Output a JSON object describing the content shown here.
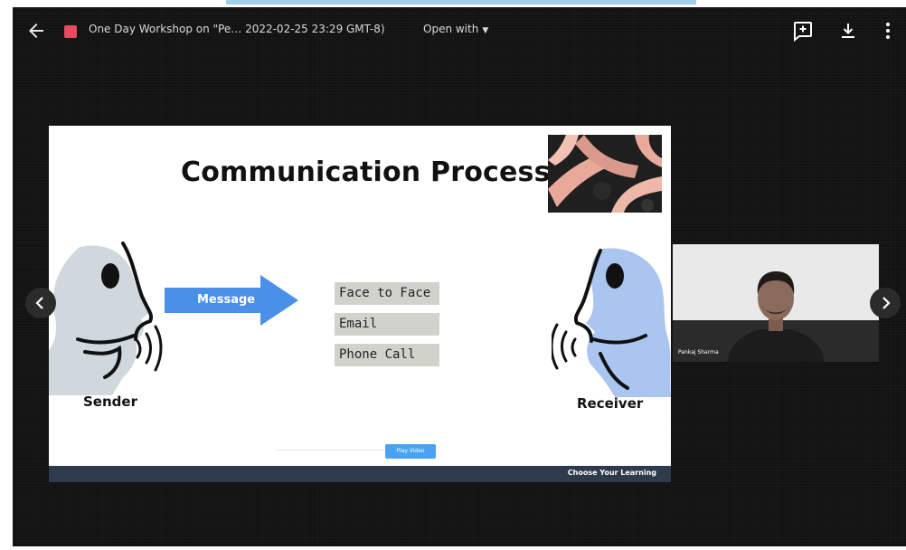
{
  "header": {
    "file_title": "One Day Workshop on \"Pe…  2022-02-25 23:29 GMT-8)",
    "open_with": "Open with",
    "icons": [
      "back-arrow-icon",
      "pdf-file-icon",
      "add-comment-icon",
      "download-icon",
      "more-vert-icon"
    ]
  },
  "slide": {
    "title": "Communication Process",
    "message_label": "Message",
    "channels": [
      "Face to Face",
      "Email",
      "Phone Call"
    ],
    "sender_label": "Sender",
    "receiver_label": "Receiver",
    "footer": "Choose Your Learning",
    "progress_label": "Play Video"
  },
  "video": {
    "participant_name": "Pankaj Sharma"
  },
  "colors": {
    "viewer_bg": "#121212",
    "arrow": "#4a8fe8",
    "sender_fill": "#cfd8dc",
    "receiver_fill": "#a9c5f0",
    "channel_bg": "#d2d2cd",
    "footer_bg": "#2f3a4c",
    "file_icon": "#e64a5f"
  }
}
